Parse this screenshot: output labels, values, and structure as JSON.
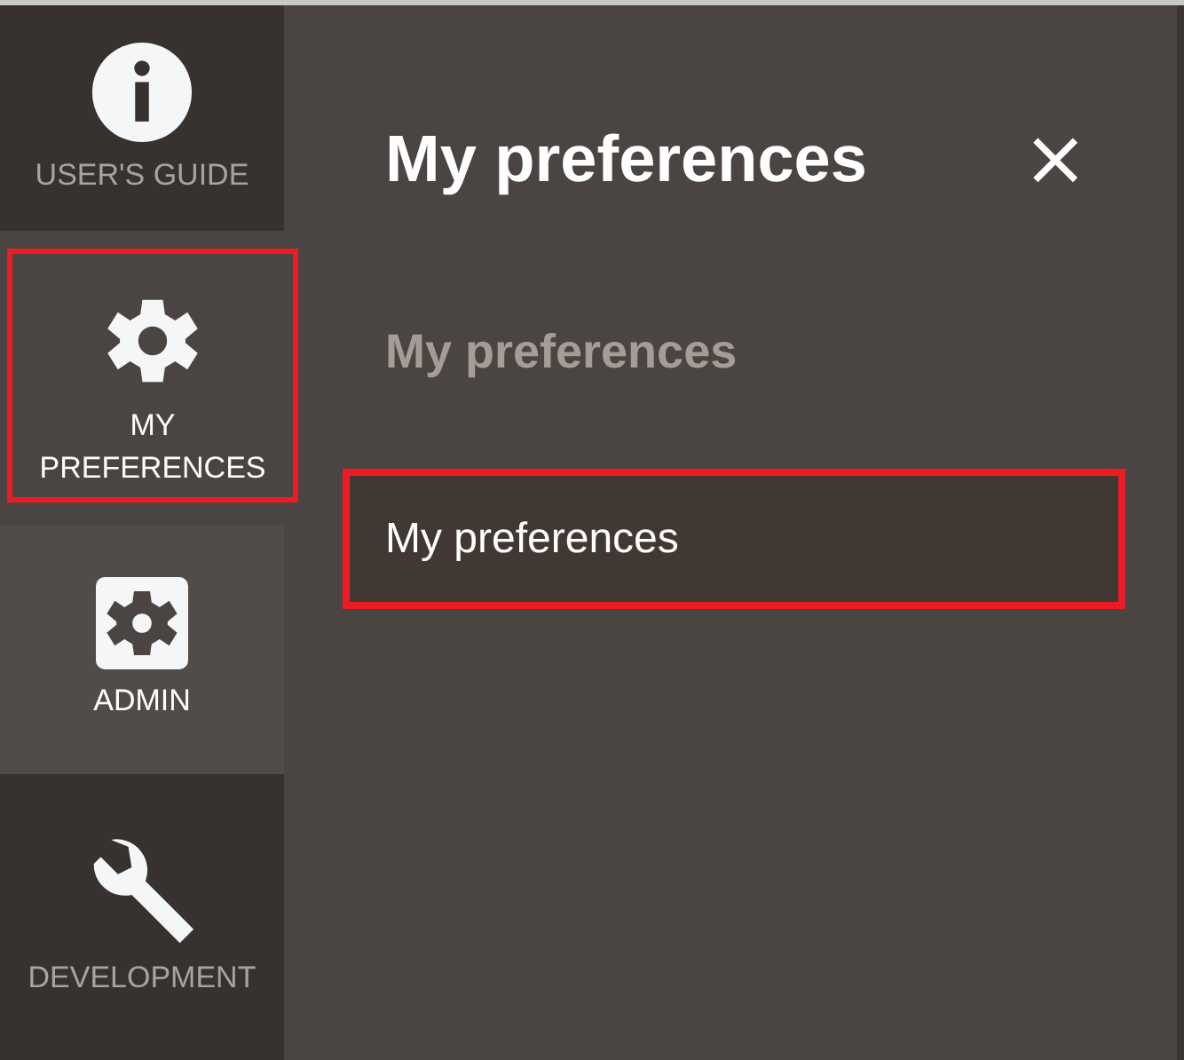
{
  "sidebar": {
    "items": [
      {
        "kind": "info",
        "label": "USER'S GUIDE",
        "active": false,
        "highlighted": false
      },
      {
        "kind": "gear",
        "label": "MY PREFERENCES",
        "active": true,
        "highlighted": true
      },
      {
        "kind": "gear-square",
        "label": "ADMIN",
        "active": true,
        "highlighted": false
      },
      {
        "kind": "wrench",
        "label": "DEVELOPMENT",
        "active": false,
        "highlighted": false
      }
    ]
  },
  "panel": {
    "title": "My preferences",
    "close": "×",
    "section": "My preferences",
    "items": [
      {
        "label": "My preferences",
        "highlighted": true
      }
    ]
  }
}
